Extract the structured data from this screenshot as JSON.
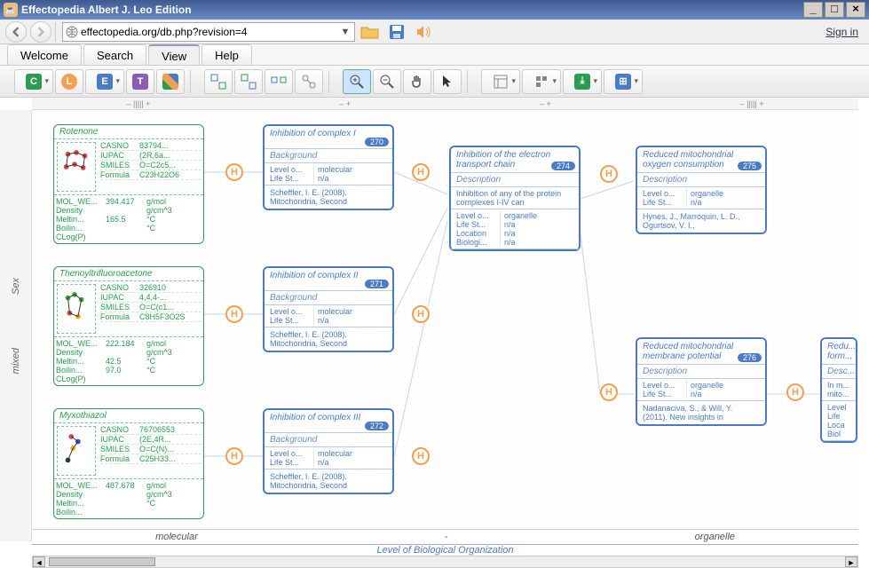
{
  "window": {
    "title": "Effectopedia  Albert J. Leo Edition"
  },
  "url": "effectopedia.org/db.php?revision=4",
  "signin": "Sign in",
  "tabs": [
    "Welcome",
    "Search",
    "View",
    "Help"
  ],
  "active_tab": 2,
  "ruler_top": [
    "– ||||| +",
    "– +",
    "– +",
    "– ||||| +"
  ],
  "axis_y_outer": "Sex",
  "axis_y_inner": "mixed",
  "axis_x_labels": [
    "molecular",
    "-",
    "organelle"
  ],
  "axis_x_title": "Level of Biological Organization",
  "chems": [
    {
      "title": "Rotenone",
      "props": {
        "CASNO": "83794...",
        "IUPAC": "(2R,6a...",
        "SMILES": "O=C2c5...",
        "Formula": "C23H22O6"
      },
      "phys": [
        [
          "MOL_WE...",
          "394.417",
          "g/mol"
        ],
        [
          "Density",
          "",
          "g/cm^3"
        ],
        [
          "Meltin...",
          "165.5",
          "°C"
        ],
        [
          "Boilin...",
          "",
          "°C"
        ],
        [
          "CLog(P)",
          "",
          ""
        ]
      ]
    },
    {
      "title": "Thenoyltrifluoroacetone",
      "props": {
        "CASNO": "326910",
        "IUPAC": "4,4,4-...",
        "SMILES": "O=C(c1...",
        "Formula": "C8H5F3O2S"
      },
      "phys": [
        [
          "MOL_WE...",
          "222.184",
          "g/mol"
        ],
        [
          "Density",
          "",
          "g/cm^3"
        ],
        [
          "Meltin...",
          "42.5",
          "°C"
        ],
        [
          "Boilin...",
          "97.0",
          "°C"
        ],
        [
          "CLog(P)",
          "",
          ""
        ]
      ]
    },
    {
      "title": "Myxothiazol",
      "props": {
        "CASNO": "76706553",
        "IUPAC": "(2E,4R...",
        "SMILES": "O=C(N)...",
        "Formula": "C25H33..."
      },
      "phys": [
        [
          "MOL_WE...",
          "487.678",
          "g/mol"
        ],
        [
          "Density",
          "",
          "g/cm^3"
        ],
        [
          "Meltin...",
          "",
          "°C"
        ],
        [
          "Boilin...",
          "",
          ""
        ]
      ]
    }
  ],
  "bio": [
    {
      "title": "Inhibition of complex I",
      "badge": "270",
      "sub": "Background",
      "grid": [
        [
          "Level o...",
          "molecular"
        ],
        [
          "Life St...",
          "n/a"
        ]
      ],
      "ref": "Scheffler, I. E. (2008).\n    Mitochondria, Second"
    },
    {
      "title": "Inhibition of complex II",
      "badge": "271",
      "sub": "Background",
      "grid": [
        [
          "Level o...",
          "molecular"
        ],
        [
          "Life St...",
          "n/a"
        ]
      ],
      "ref": "Scheffler, I. E. (2008).\n    Mitochondria, Second"
    },
    {
      "title": "Inhibition of complex III",
      "badge": "272",
      "sub": "Background",
      "grid": [
        [
          "Level o...",
          "molecular"
        ],
        [
          "Life St...",
          "n/a"
        ]
      ],
      "ref": "Scheffler, I. E. (2008).\n    Mitochondria, Second"
    },
    {
      "title": "Inhibition of the electron transport chain",
      "badge": "274",
      "sub": "Description",
      "desc": "Inhibition of any of the protein complexes I-IV can",
      "grid": [
        [
          "Level o...",
          "organelle"
        ],
        [
          "Life St...",
          "n/a"
        ],
        [
          "Location",
          "n/a"
        ],
        [
          "Biologi...",
          "n/a"
        ]
      ],
      "ref": ""
    },
    {
      "title": "Reduced mitochondrial oxygen consumption",
      "badge": "275",
      "sub": "Description",
      "grid": [
        [
          "Level o...",
          "organelle"
        ],
        [
          "Life St...",
          "n/a"
        ]
      ],
      "ref": "Hynes, J., Marroquin, L. D.,\n    Ogurtsov, V. I.,"
    },
    {
      "title": "Reduced mitochondrial membrane potential",
      "badge": "276",
      "sub": "Description",
      "grid": [
        [
          "Level o...",
          "organelle"
        ],
        [
          "Life St...",
          "n/a"
        ]
      ],
      "ref": "Nadanaciva, S., & Will, Y.\n    (2011). New insights in"
    }
  ],
  "bio_partial": {
    "title": "Redu... form...",
    "sub": "Desc...",
    "desc": "In m... mito...",
    "grid": [
      [
        "Level",
        "..."
      ],
      [
        "Life",
        "..."
      ],
      [
        "Loca",
        "..."
      ],
      [
        "Biol",
        "..."
      ]
    ]
  },
  "link_label": "H"
}
